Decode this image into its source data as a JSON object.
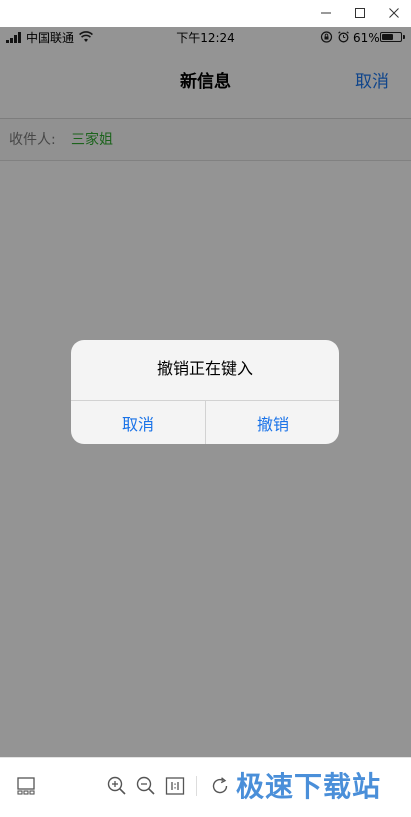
{
  "status_bar": {
    "carrier": "中国联通",
    "time": "下午12:24",
    "battery_percent": "61%",
    "battery_level": 0.61
  },
  "nav": {
    "title": "新信息",
    "cancel": "取消"
  },
  "recipient": {
    "label": "收件人:",
    "name": "三家姐"
  },
  "alert": {
    "title": "撤销正在键入",
    "cancel": "取消",
    "confirm": "撤销"
  },
  "watermark": "极速下载站",
  "colors": {
    "accent": "#1a73e8",
    "recipient_name": "#2fa52f",
    "watermark": "#4a8fd9"
  }
}
